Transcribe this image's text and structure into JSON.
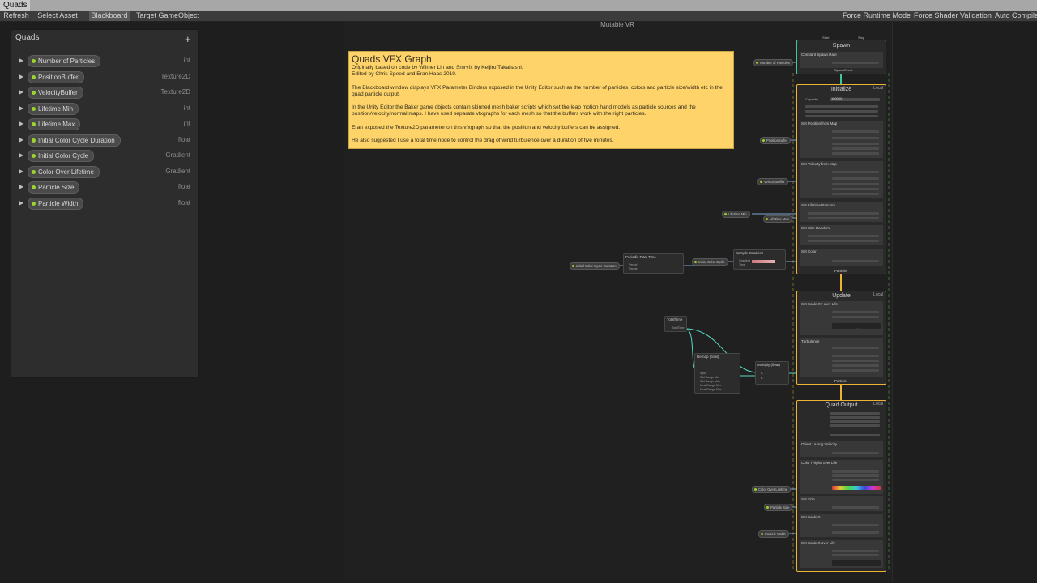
{
  "window_tab": "Quads",
  "toolbar": {
    "refresh": "Refresh",
    "select_asset": "Select Asset",
    "blackboard": "Blackboard",
    "target_gameobject": "Target GameObject",
    "force_runtime_mode": "Force Runtime Mode",
    "force_shader_validation": "Force Shader Validation",
    "auto_compile": "Auto Compile"
  },
  "graph_title": "Mutable VR",
  "blackboard": {
    "title": "Quads",
    "add_symbol": "+",
    "items": [
      {
        "name": "Number of Particles",
        "type": "int"
      },
      {
        "name": "PositionBuffer",
        "type": "Texture2D"
      },
      {
        "name": "VelocityBuffer",
        "type": "Texture2D"
      },
      {
        "name": "Lifetime Min",
        "type": "int"
      },
      {
        "name": "Lifetime Max",
        "type": "int"
      },
      {
        "name": "Initial Color Cycle Duration",
        "type": "float"
      },
      {
        "name": "Initial Color Cycle",
        "type": "Gradient"
      },
      {
        "name": "Color Over Lifetime",
        "type": "Gradient"
      },
      {
        "name": "Particle Size",
        "type": "float"
      },
      {
        "name": "Particle Width",
        "type": "float"
      }
    ]
  },
  "sticky_note": {
    "title": "Quads VFX Graph",
    "line1": "Originally based on code by Wilmer Lin and Smrvfx by Keijiro Takahashi.",
    "line2": "Edited by Chris Speed and Eran Haas 2019.",
    "para1": "The Blackboard window displays VFX Parameter Binders exposed in the Unity Editor such as the number of particles, colors and particle size/width etc in the quad particle output.",
    "para2": "In the Unity Editor the Baker game objects contain skinned mesh baker scripts which set the leap motion hand models as particle sources and the position/velocity/normal maps. I have used separate vfxgraphs for each mesh so that the buffers work with the right particles.",
    "para3": "Eran exposed the Texture2D parameter on this vfxgraph so that the position and velocity buffers can be assigned.",
    "para4": "He also suggested I use a total time node to control the drag of wind turbulence over a duration of five minutes."
  },
  "contexts": {
    "spawn": {
      "title": "Spawn",
      "block": "Constant Spawn Rate",
      "port_start": "Start",
      "port_stop": "Stop",
      "flow_out": "SpawnEvent"
    },
    "initialize": {
      "title": "Initialize",
      "cap": "Local",
      "capacity_label": "Capacity",
      "capacity_value": "100000",
      "blocks": [
        "Set Position from Map",
        "Set Velocity from Map",
        "Set Lifetime Random",
        "Set Size Random",
        "Set Color"
      ]
    },
    "update": {
      "title": "Update",
      "cap": "Local",
      "blocks": [
        "Set Scale XY over Life",
        "Turbulence"
      ]
    },
    "output": {
      "title": "Quad Output",
      "cap": "Local",
      "blocks": [
        "Orient : Along Velocity",
        "Color / Alpha over Life",
        "Set Size",
        "Set Scale.X",
        "Set Scale.X over Life"
      ]
    },
    "flow_label": "Particle"
  },
  "param_pills": {
    "num_particles": "Number of Particles",
    "position_buffer": "PositionBuffer",
    "velocity_buffer": "VelocityBuffer",
    "lifetime_min": "Lifetime Min",
    "lifetime_max": "Lifetime Max",
    "cycle_duration": "Initial Color Cycle Duration",
    "initial_cycle": "Initial Color Cycle",
    "color_over_life": "Color Over Lifetime",
    "particle_size": "Particle Size",
    "particle_width": "Particle Width"
  },
  "operators": {
    "periodic": {
      "title": "Periodic Total Time",
      "row1": "Period",
      "row2": "Range"
    },
    "sample_gradient": {
      "title": "Sample Gradient",
      "row1": "Gradient",
      "row2": "Time"
    },
    "total_time": {
      "title": "TotalTime",
      "row1": "TotalTime"
    },
    "remap": {
      "title": "Remap (float)",
      "row1": "Input",
      "row2": "Old Range Min",
      "row3": "Old Range Max",
      "row4": "New Range Min",
      "row5": "New Range Max"
    },
    "multiply": {
      "title": "Multiply (float)",
      "row1": "A",
      "row2": "B"
    }
  }
}
